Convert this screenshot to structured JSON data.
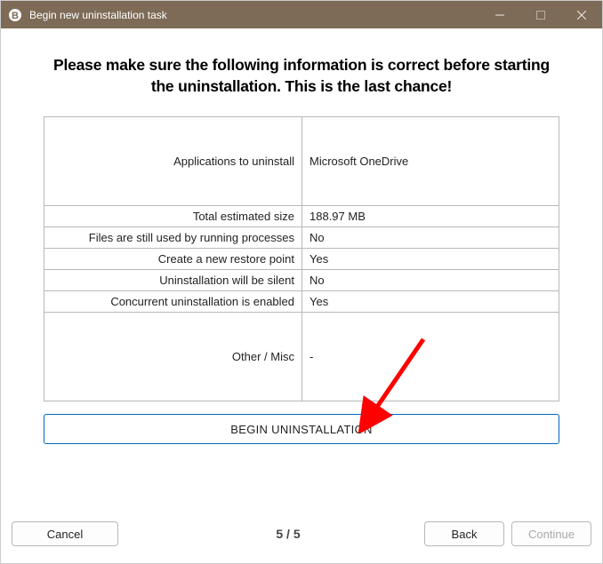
{
  "window": {
    "title": "Begin new uninstallation task"
  },
  "heading": "Please make sure the following information is correct before starting the uninstallation. This is the last chance!",
  "rows": {
    "applications_label": "Applications to uninstall",
    "applications_value": "Microsoft OneDrive",
    "size_label": "Total estimated size",
    "size_value": "188.97 MB",
    "files_label": "Files are still used by running processes",
    "files_value": "No",
    "restore_label": "Create a new restore point",
    "restore_value": "Yes",
    "silent_label": "Uninstallation will be silent",
    "silent_value": "No",
    "concurrent_label": "Concurrent uninstallation is enabled",
    "concurrent_value": "Yes",
    "other_label": "Other / Misc",
    "other_value": "-"
  },
  "buttons": {
    "begin": "BEGIN UNINSTALLATION",
    "cancel": "Cancel",
    "back": "Back",
    "continue": "Continue"
  },
  "footer": {
    "page": "5 / 5"
  }
}
